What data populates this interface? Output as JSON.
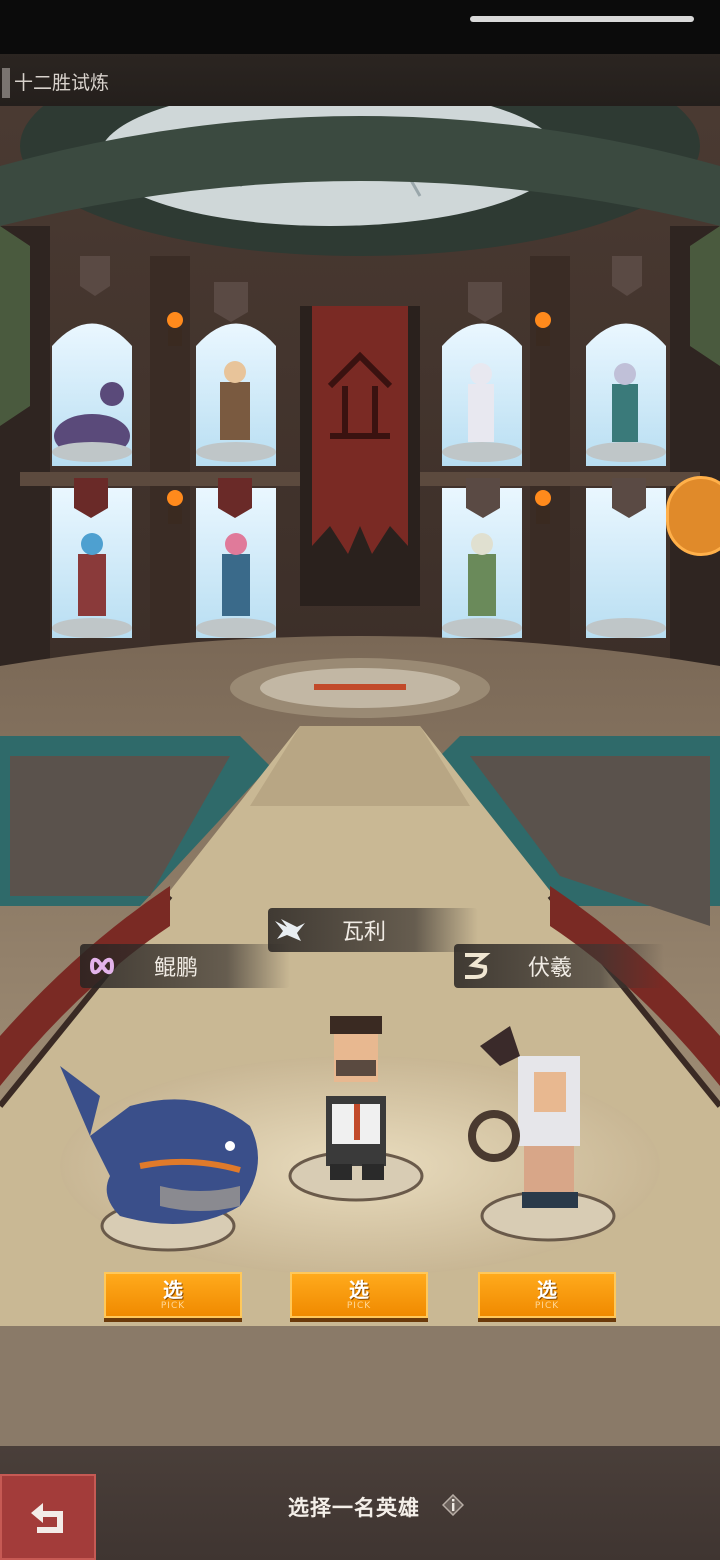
{
  "header": {
    "title": "十二胜试炼"
  },
  "colors": {
    "pick_button": "#f7931e",
    "back_button": "#a33c3a",
    "banner": "#7a2a24"
  },
  "heroes": [
    {
      "name": "鲲鹏",
      "icon": "infinity-emblem-icon",
      "pick_label": "选",
      "pick_sub": "PICK"
    },
    {
      "name": "瓦利",
      "icon": "bird-emblem-icon",
      "pick_label": "选",
      "pick_sub": "PICK"
    },
    {
      "name": "伏羲",
      "icon": "serpent-emblem-icon",
      "pick_label": "选",
      "pick_sub": "PICK"
    }
  ],
  "footer": {
    "instruction": "选择一名英雄",
    "back_icon": "return-arrow-icon",
    "info_icon": "info-icon"
  }
}
